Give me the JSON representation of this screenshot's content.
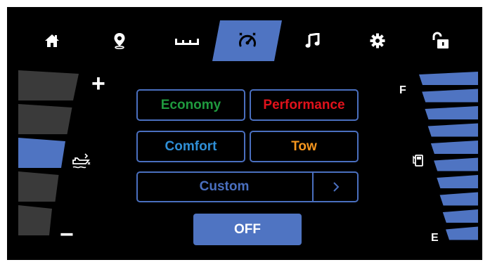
{
  "nav": {
    "items": [
      {
        "icon": "home-icon",
        "active": false
      },
      {
        "icon": "location-pin-icon",
        "active": false
      },
      {
        "icon": "ruler-icon",
        "active": false
      },
      {
        "icon": "drive-mode-icon",
        "active": true
      },
      {
        "icon": "music-note-icon",
        "active": false
      },
      {
        "icon": "gear-icon",
        "active": false
      },
      {
        "icon": "unlocked-padlock-icon",
        "active": false
      }
    ]
  },
  "trim": {
    "plus_label": "+",
    "minus_label": "−",
    "icon": "boat-trim-icon",
    "level": 3,
    "segments": 5
  },
  "modes": {
    "economy": "Economy",
    "performance": "Performance",
    "comfort": "Comfort",
    "tow": "Tow",
    "custom": "Custom",
    "custom_arrow": "›",
    "off": "OFF"
  },
  "fuel": {
    "full_label": "F",
    "empty_label": "E",
    "icon": "fuel-pump-icon",
    "segments": 10,
    "filled_segments": 10
  },
  "colors": {
    "accent": "#4f74c2",
    "inactive_segment": "#3a3a3a",
    "economy": "#1f9a3e",
    "performance": "#e0121b",
    "comfort": "#2f8fd6",
    "tow": "#f5961e",
    "custom": "#4a6fbf"
  }
}
